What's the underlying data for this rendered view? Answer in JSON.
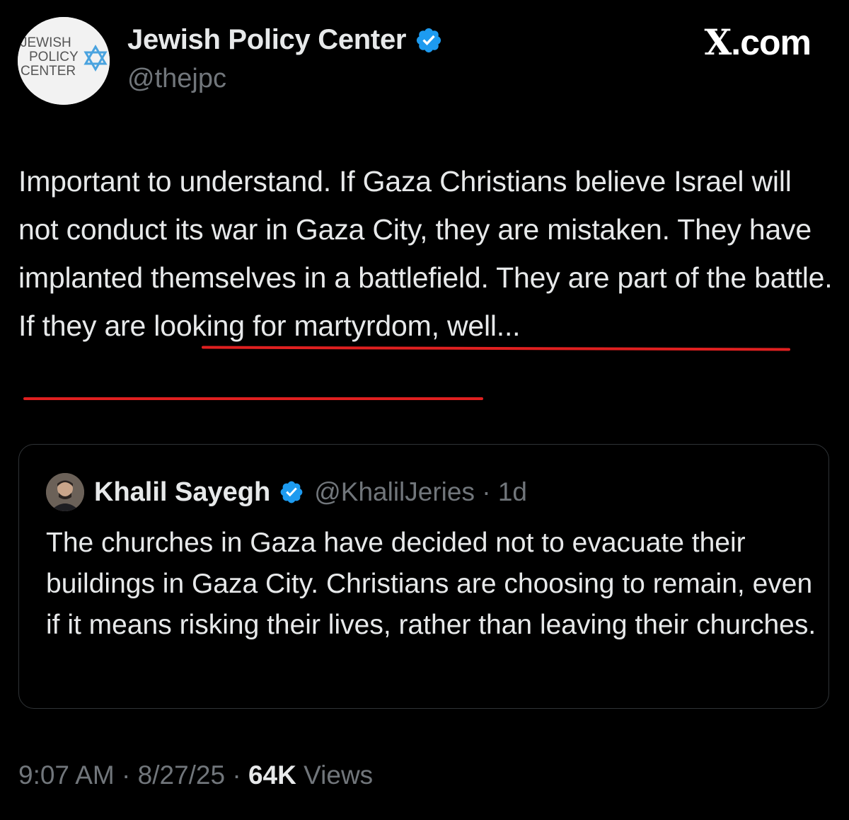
{
  "author": {
    "display_name": "Jewish Policy Center",
    "handle": "@thejpc",
    "verified_icon": "verified-badge-icon",
    "avatar": {
      "logo_lines": [
        "JEWISH",
        "POLICY",
        "CENTER"
      ]
    }
  },
  "brand": {
    "label_x": "X",
    "label_rest": ".com"
  },
  "tweet": {
    "text_part1": "Important to understand. If Gaza Christians believe Israel will not conduct its war in Gaza City, they are mistaken. They have implanted themselves in a battlefield. ",
    "text_part2": "They are part of the battle. If they are looking for martyrdom, well..."
  },
  "quote": {
    "display_name": "Khalil Sayegh",
    "handle_and_time": "@KhalilJeries · 1d",
    "text": "The churches in Gaza have decided not to evacuate their buildings in Gaza City. Christians are choosing to remain, even if it means risking their lives, rather than leaving their churches."
  },
  "meta": {
    "time_date": "9:07 AM · 8/27/25 · ",
    "views_count": "64K",
    "views_label": " Views"
  },
  "colors": {
    "background": "#000000",
    "text": "#e7e9ea",
    "secondary": "#71767b",
    "verified": "#1d9bf0",
    "underline": "#e02020",
    "logo_blue": "#4aa3df"
  }
}
